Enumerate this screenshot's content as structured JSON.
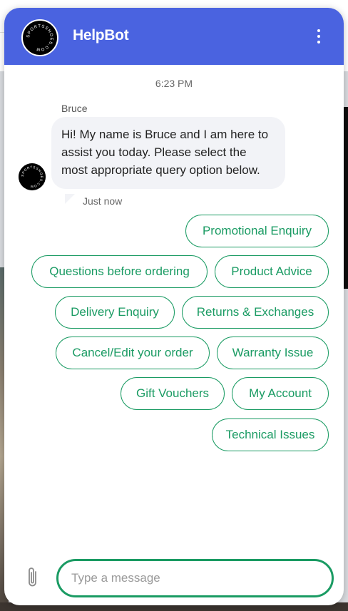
{
  "header": {
    "title": "HelpBot",
    "logo_text": "SPORTSSHOES.COM"
  },
  "conversation": {
    "time": "6:23 PM",
    "sender": "Bruce",
    "message": "Hi! My name is Bruce and I am here to assist you today. Please select the most appropriate query option below.",
    "sent_label": "Just now"
  },
  "quick_replies": [
    "Promotional Enquiry",
    "Questions before ordering",
    "Product Advice",
    "Delivery Enquiry",
    "Returns & Exchanges",
    "Cancel/Edit your order",
    "Warranty Issue",
    "Gift Vouchers",
    "My Account",
    "Technical Issues"
  ],
  "composer": {
    "placeholder": "Type a message"
  },
  "colors": {
    "header": "#4a63e0",
    "accent": "#1a9b63",
    "bubble": "#f2f3f7"
  },
  "icons": {
    "menu": "kebab-menu-icon",
    "attach": "paperclip-icon"
  }
}
